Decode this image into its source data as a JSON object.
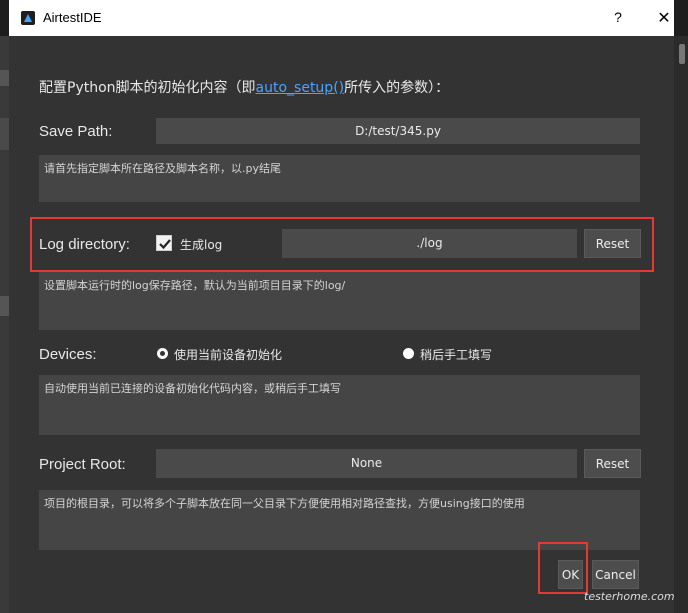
{
  "window": {
    "title": "AirtestIDE",
    "help_label": "?",
    "close_label": "✕"
  },
  "intro": {
    "prefix": "配置Python脚本的初始化内容（即",
    "link": "auto_setup()",
    "suffix": "所传入的参数）："
  },
  "save_path": {
    "label": "Save Path:",
    "value": "D:/test/345.py",
    "description": "请首先指定脚本所在路径及脚本名称，以.py结尾"
  },
  "log_directory": {
    "label": "Log directory:",
    "checkbox_label": "生成log",
    "checked": true,
    "value": "./log",
    "reset_label": "Reset",
    "description": "设置脚本运行时的log保存路径，默认为当前项目目录下的log/"
  },
  "devices": {
    "label": "Devices:",
    "options": [
      "使用当前设备初始化",
      "稍后手工填写"
    ],
    "selected_index": 0,
    "description": "自动使用当前已连接的设备初始化代码内容，或稍后手工填写"
  },
  "project_root": {
    "label": "Project Root:",
    "value": "None",
    "reset_label": "Reset",
    "description": "项目的根目录，可以将多个子脚本放在同一父目录下方便使用相对路径查找，方便using接口的使用"
  },
  "footer": {
    "ok_label": "OK",
    "cancel_label": "Cancel"
  },
  "watermark": "testerhome.com",
  "colors": {
    "highlight": "#e53935",
    "link": "#4aa3ff",
    "dialog_bg": "#333333"
  }
}
